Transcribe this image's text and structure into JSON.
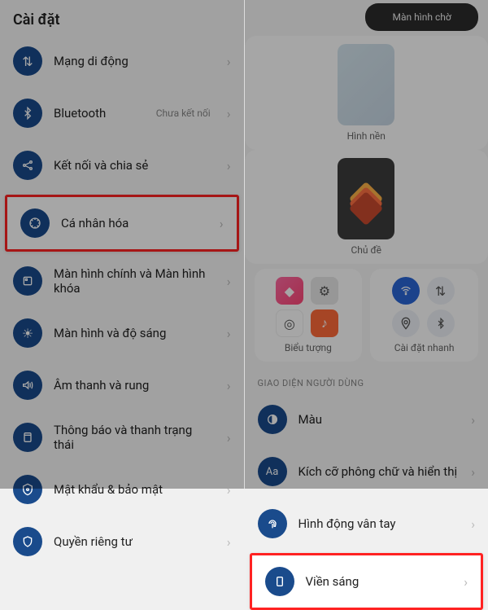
{
  "left": {
    "header": "Cài đặt",
    "items": [
      {
        "label": "Mạng di động",
        "icon": "swap"
      },
      {
        "label": "Bluetooth",
        "sub": "Chưa kết nối",
        "icon": "bluetooth"
      },
      {
        "label": "Kết nối và chia sẻ",
        "icon": "share"
      },
      {
        "label": "Cá nhân hóa",
        "icon": "personalize",
        "highlight": true
      },
      {
        "label": "Màn hình chính và Màn hình khóa",
        "icon": "home"
      },
      {
        "label": "Màn hình và độ sáng",
        "icon": "brightness"
      },
      {
        "label": "Âm thanh và rung",
        "icon": "sound"
      },
      {
        "label": "Thông báo và thanh trạng thái",
        "icon": "notification"
      },
      {
        "label": "Mật khẩu & bảo mật",
        "icon": "lock"
      },
      {
        "label": "Quyền riêng tư",
        "icon": "privacy"
      }
    ]
  },
  "right": {
    "homescreen_chip": "Màn hình chờ",
    "wallpaper": "Hình nền",
    "theme": "Chủ đề",
    "icons": "Biểu tượng",
    "quick_settings": "Cài đặt nhanh",
    "section": "GIAO DIỆN NGƯỜI DÙNG",
    "items": [
      {
        "label": "Màu",
        "icon": "color"
      },
      {
        "label": "Kích cỡ phông chữ và hiển thị",
        "icon": "font"
      },
      {
        "label": "Hình động vân tay",
        "icon": "fingerprint"
      },
      {
        "label": "Viền sáng",
        "icon": "edge",
        "highlight": true
      }
    ]
  }
}
